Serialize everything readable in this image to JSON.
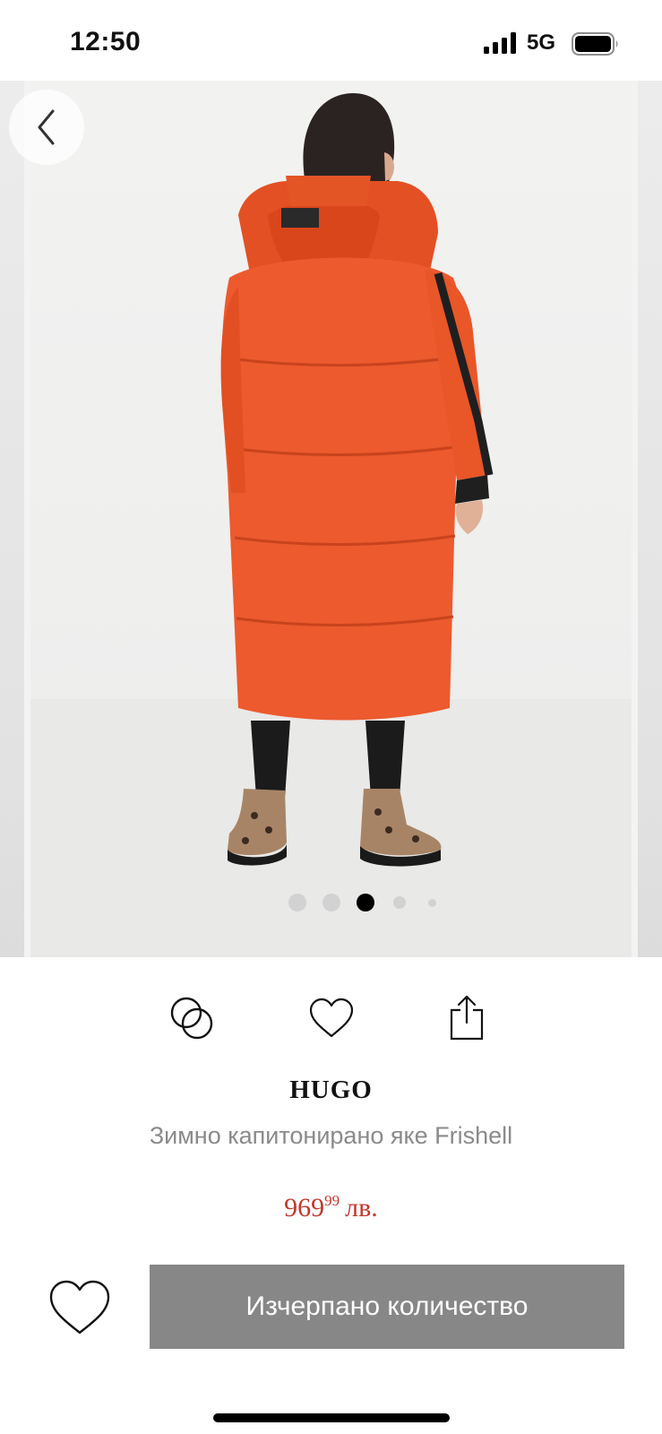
{
  "status_bar": {
    "time": "12:50",
    "network": "5G",
    "icons": [
      "signal-icon",
      "battery-icon"
    ]
  },
  "gallery": {
    "total_images": 5,
    "active_index": 2,
    "back_icon": "chevron-left-icon"
  },
  "actions": {
    "icons": [
      "compare-icon",
      "heart-outline-icon",
      "share-icon"
    ]
  },
  "product": {
    "brand": "HUGO",
    "name": "Зимно капитонирано яке Frishell",
    "price_main": "969",
    "price_cents": "99",
    "currency": "лв."
  },
  "cta": {
    "label": "Изчерпано количество",
    "favorite_icon": "heart-outline-icon"
  },
  "colors": {
    "price": "#c0392b",
    "cta_background": "#878787",
    "coat": "#ec5a2e"
  }
}
